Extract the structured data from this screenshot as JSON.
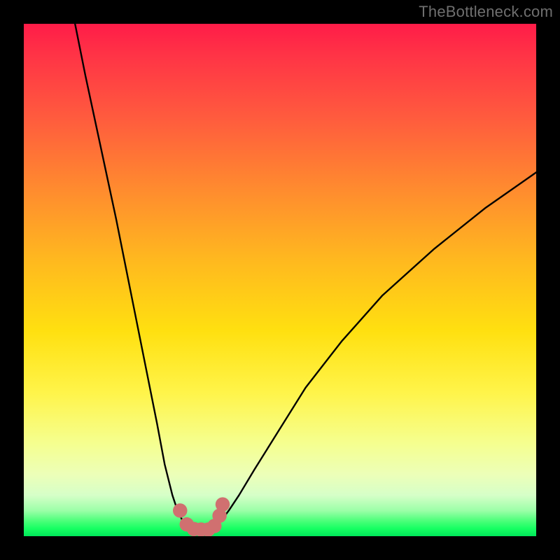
{
  "watermark": {
    "text": "TheBottleneck.com"
  },
  "colors": {
    "background": "#000000",
    "curve": "#000000",
    "marker_fill": "#d07070",
    "marker_stroke": "#c25e5e"
  },
  "chart_data": {
    "type": "line",
    "title": "",
    "xlabel": "",
    "ylabel": "",
    "xlim": [
      0,
      100
    ],
    "ylim": [
      0,
      100
    ],
    "grid": false,
    "legend": false,
    "note": "Values estimated from pixel positions; y is inverted (0 at bottom).",
    "series": [
      {
        "name": "left-branch",
        "x": [
          10,
          12,
          15,
          18,
          20,
          22,
          24,
          26,
          27.5,
          29,
          30,
          31,
          32,
          33
        ],
        "y": [
          100,
          90,
          76,
          62,
          52,
          42,
          32,
          22,
          14,
          8,
          5,
          3,
          2,
          1.5
        ]
      },
      {
        "name": "right-branch",
        "x": [
          37,
          38.5,
          40,
          42,
          45,
          50,
          55,
          62,
          70,
          80,
          90,
          100
        ],
        "y": [
          1.5,
          3,
          5,
          8,
          13,
          21,
          29,
          38,
          47,
          56,
          64,
          71
        ]
      },
      {
        "name": "floor",
        "x": [
          33,
          34,
          35,
          36,
          37
        ],
        "y": [
          1.5,
          1.2,
          1.2,
          1.2,
          1.5
        ]
      }
    ],
    "markers": {
      "name": "highlight-dots",
      "points": [
        {
          "x": 30.5,
          "y": 5.0
        },
        {
          "x": 31.8,
          "y": 2.3
        },
        {
          "x": 33.2,
          "y": 1.4
        },
        {
          "x": 34.6,
          "y": 1.3
        },
        {
          "x": 36.0,
          "y": 1.3
        },
        {
          "x": 37.2,
          "y": 2.0
        },
        {
          "x": 38.2,
          "y": 4.0
        },
        {
          "x": 38.8,
          "y": 6.2
        }
      ],
      "radius_pct": 1.4
    }
  }
}
